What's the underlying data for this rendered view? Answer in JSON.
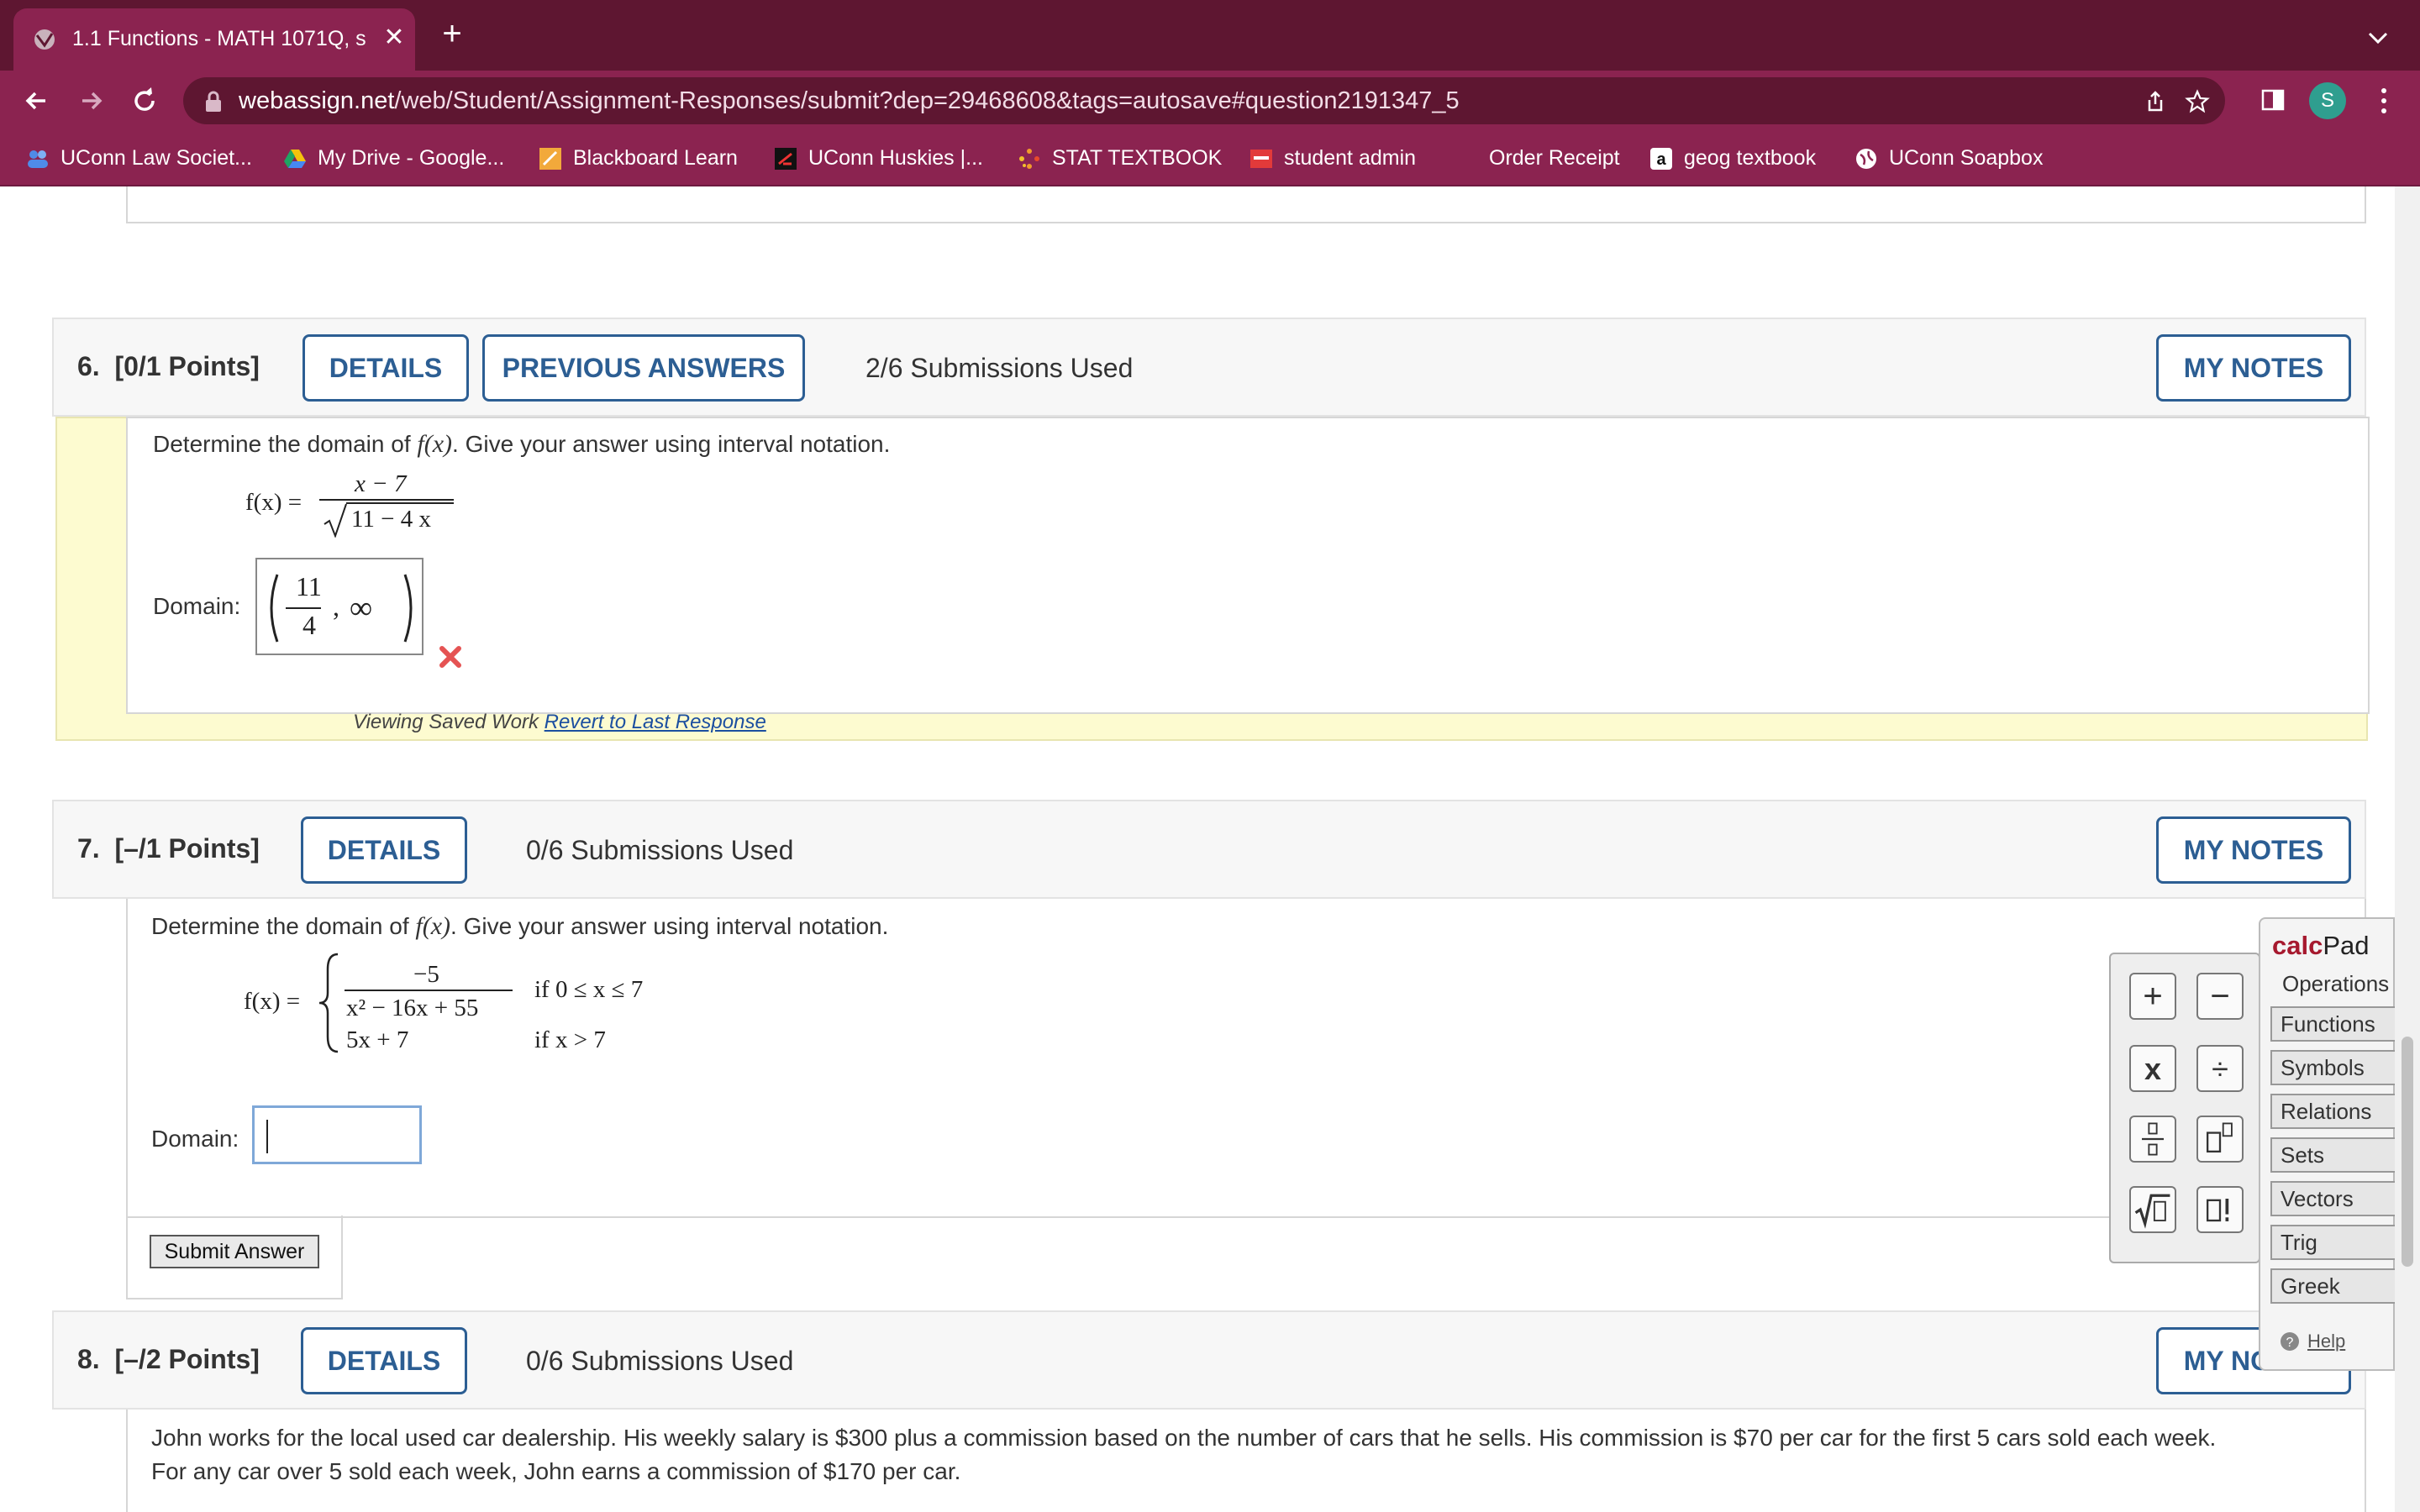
{
  "browser": {
    "tab_title": "1.1 Functions - MATH 1071Q, s",
    "tab_close": "✕",
    "new_tab": "+",
    "url_host": "webassign.net",
    "url_path": "/web/Student/Assignment-Responses/submit?dep=29468608&tags=autosave#question2191347_5",
    "profile_initial": "S",
    "accent_color": "#8b2350",
    "bookmarks": [
      {
        "label": "UConn Law Societ...",
        "icon": "people-icon"
      },
      {
        "label": "My Drive - Google...",
        "icon": "google-drive-icon"
      },
      {
        "label": "Blackboard Learn",
        "icon": "blackboard-icon"
      },
      {
        "label": "UConn Huskies |...",
        "icon": "huskies-icon"
      },
      {
        "label": "STAT TEXTBOOK",
        "icon": "stat-textbook-icon"
      },
      {
        "label": "student admin",
        "icon": "student-admin-icon"
      },
      {
        "label": "Order Receipt",
        "icon": ""
      },
      {
        "label": "geog textbook",
        "icon": "amazon-icon"
      },
      {
        "label": "UConn Soapbox",
        "icon": "globe-icon"
      }
    ]
  },
  "q6": {
    "number": "6.",
    "points": "[0/1 Points]",
    "details": "DETAILS",
    "previous_answers": "PREVIOUS ANSWERS",
    "submissions": "2/6 Submissions Used",
    "my_notes": "MY NOTES",
    "prompt_pre": "Determine the domain of ",
    "prompt_fx": "f(x)",
    "prompt_post": ". Give your answer using interval notation.",
    "func_lhs": "f(x) =",
    "numerator": "x − 7",
    "denominator": "11 − 4 x",
    "domain_label": "Domain:",
    "answer_num": "11",
    "answer_den": "4",
    "answer_sep": ",",
    "answer_inf": "∞",
    "status": "incorrect",
    "saved_text": "Viewing Saved Work ",
    "revert_link": "Revert to Last Response"
  },
  "q7": {
    "number": "7.",
    "points": "[–/1 Points]",
    "details": "DETAILS",
    "submissions": "0/6 Submissions Used",
    "my_notes": "MY NOTES",
    "prompt_pre": "Determine the domain of ",
    "prompt_fx": "f(x)",
    "prompt_post": ". Give your answer using interval notation.",
    "func_lhs": "f(x) =",
    "piece1_num": "−5",
    "piece1_den": "x² − 16x + 55",
    "piece1_cond": "if 0 ≤ x ≤ 7",
    "piece2_expr": "5x + 7",
    "piece2_cond": "if  x > 7",
    "domain_label": "Domain:",
    "domain_value": "",
    "submit": "Submit Answer"
  },
  "q8": {
    "number": "8.",
    "points": "[–/2 Points]",
    "details": "DETAILS",
    "submissions": "0/6 Submissions Used",
    "my_notes": "MY NOTES",
    "line1": "John works for the local used car dealership. His weekly salary is $300 plus a commission based on the number of cars that he sells. His commission is $70 per car for the first 5 cars sold each week.",
    "line2": "For any car over 5 sold each week, John earns a commission of $170 per car."
  },
  "calcpad": {
    "title_a": "calc",
    "title_b": "Pad",
    "operations": "Operations",
    "menu": [
      "Functions",
      "Symbols",
      "Relations",
      "Sets",
      "Vectors",
      "Trig",
      "Greek"
    ],
    "help": "Help",
    "keys": [
      "+",
      "−",
      "x",
      "÷"
    ]
  }
}
